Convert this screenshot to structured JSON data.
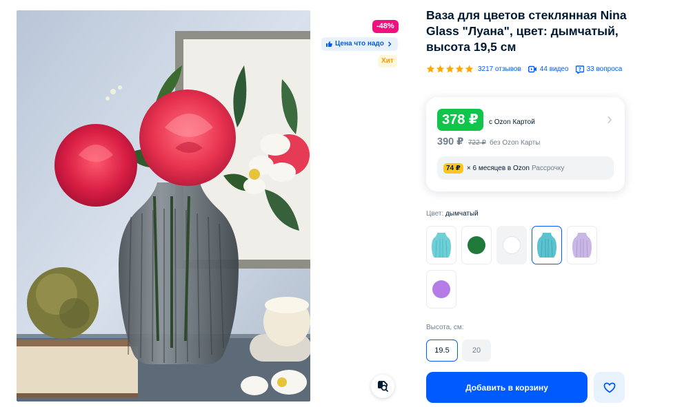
{
  "product": {
    "title": "Ваза для цветов стеклянная Nina Glass \"Луана\", цвет: дымчатый, высота 19,5 см",
    "photo_alt": "Ваза для цветов стеклянная Nina Glass Луана"
  },
  "badges": {
    "discount": "-48%",
    "good_price": "Цена что надо",
    "hit": "Хит"
  },
  "rating": {
    "stars": 5,
    "reviews": "3217 отзывов",
    "videos": "44 видео",
    "questions": "33 вопроса"
  },
  "price": {
    "card_price": "378 ₽",
    "card_caption": "с Ozon Картой",
    "regular_price": "390 ₽",
    "old_price": "722 ₽",
    "regular_caption": "без Ozon Карты",
    "installment_amount": "74 ₽",
    "installment_text": "× 6 месяцев в Ozon",
    "installment_muted": "Рассрочку"
  },
  "color": {
    "label": "Цвет:",
    "value": "дымчатый",
    "swatches": [
      {
        "name": "голубой",
        "hex": "#6fcfd6",
        "kind": "vase"
      },
      {
        "name": "зелёный",
        "hex": "#1f7a3a",
        "kind": "dot"
      },
      {
        "name": "белый",
        "hex": "#ffffff",
        "kind": "dot"
      },
      {
        "name": "дымчатый",
        "hex": "#5bc2cf",
        "kind": "vase",
        "selected": true
      },
      {
        "name": "сиреневый",
        "hex": "#c9b7e6",
        "kind": "vase"
      },
      {
        "name": "фиолетовый",
        "hex": "#b57ce8",
        "kind": "dot"
      }
    ]
  },
  "height": {
    "label": "Высота, см:",
    "options": [
      "19.5",
      "20"
    ],
    "selected": "19.5"
  },
  "actions": {
    "add_to_cart": "Добавить в корзину"
  },
  "colors": {
    "accent": "#005bff",
    "price_green": "#10c44c",
    "discount_pink": "#f1117e",
    "star_yellow": "#ffa800"
  }
}
